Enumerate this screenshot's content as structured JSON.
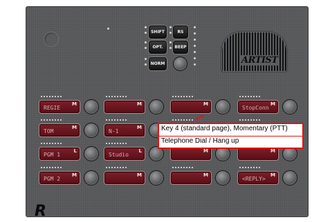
{
  "station": {
    "brand": "ARTIST",
    "footer_logo": "R"
  },
  "control_buttons": [
    {
      "label": "SHIFT",
      "name": "shift-button"
    },
    {
      "label": "RS",
      "name": "rs-button"
    },
    {
      "label": "OPT.",
      "name": "opt-button"
    },
    {
      "label": "BEEP",
      "name": "beep-button"
    },
    {
      "label": "NORM",
      "name": "norm-button"
    }
  ],
  "keys": [
    {
      "label": "REGIE",
      "mode": "M"
    },
    {
      "label": "",
      "mode": "M"
    },
    {
      "label": "",
      "mode": "M"
    },
    {
      "label": "StopConn",
      "mode": "M"
    },
    {
      "label": "TOM",
      "mode": "M"
    },
    {
      "label": "N-1",
      "mode": "M"
    },
    {
      "label": "",
      "mode": ""
    },
    {
      "label": "",
      "mode": ""
    },
    {
      "label": "PGM 1",
      "mode": "L"
    },
    {
      "label": "Studio",
      "mode": "L"
    },
    {
      "label": "",
      "mode": "M"
    },
    {
      "label": "",
      "mode": "M"
    },
    {
      "label": "PGM 2",
      "mode": "M"
    },
    {
      "label": "",
      "mode": "M"
    },
    {
      "label": "",
      "mode": "M"
    },
    {
      "label": "<REPLY>",
      "mode": "M"
    }
  ],
  "tooltip": {
    "line1": "Key 4 (standard page), Momentary (PTT)",
    "line2": "Telephone Dial / Hang up"
  },
  "colors": {
    "panel": "#5c5d5f",
    "key_face": "#6b1620",
    "tooltip_border": "#e01414"
  }
}
